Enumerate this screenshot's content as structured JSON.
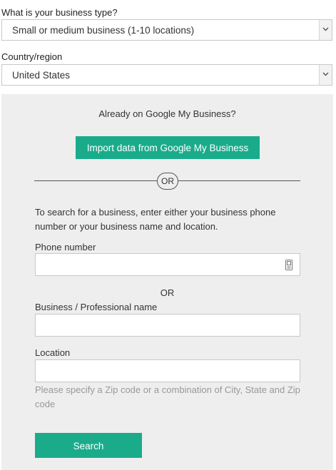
{
  "business_type": {
    "label": "What is your business type?",
    "selected": "Small or medium business (1-10 locations)"
  },
  "country": {
    "label": "Country/region",
    "selected": "United States"
  },
  "google_my_business": {
    "prompt": "Already on Google My Business?",
    "import_button": "Import data from Google My Business"
  },
  "divider_or": "OR",
  "instructions": "To search for a business, enter either your business phone number or your business name and location.",
  "phone": {
    "label": "Phone number",
    "value": "",
    "icon": "phone-icon"
  },
  "or_text": "OR",
  "business_name": {
    "label": "Business / Professional name",
    "value": ""
  },
  "location": {
    "label": "Location",
    "value": "",
    "hint": "Please specify a Zip code or a combination of City, State and Zip code"
  },
  "search_button": "Search",
  "colors": {
    "accent": "#1aab8b",
    "panel_bg": "#eeeeee",
    "hint_text": "#999999"
  }
}
